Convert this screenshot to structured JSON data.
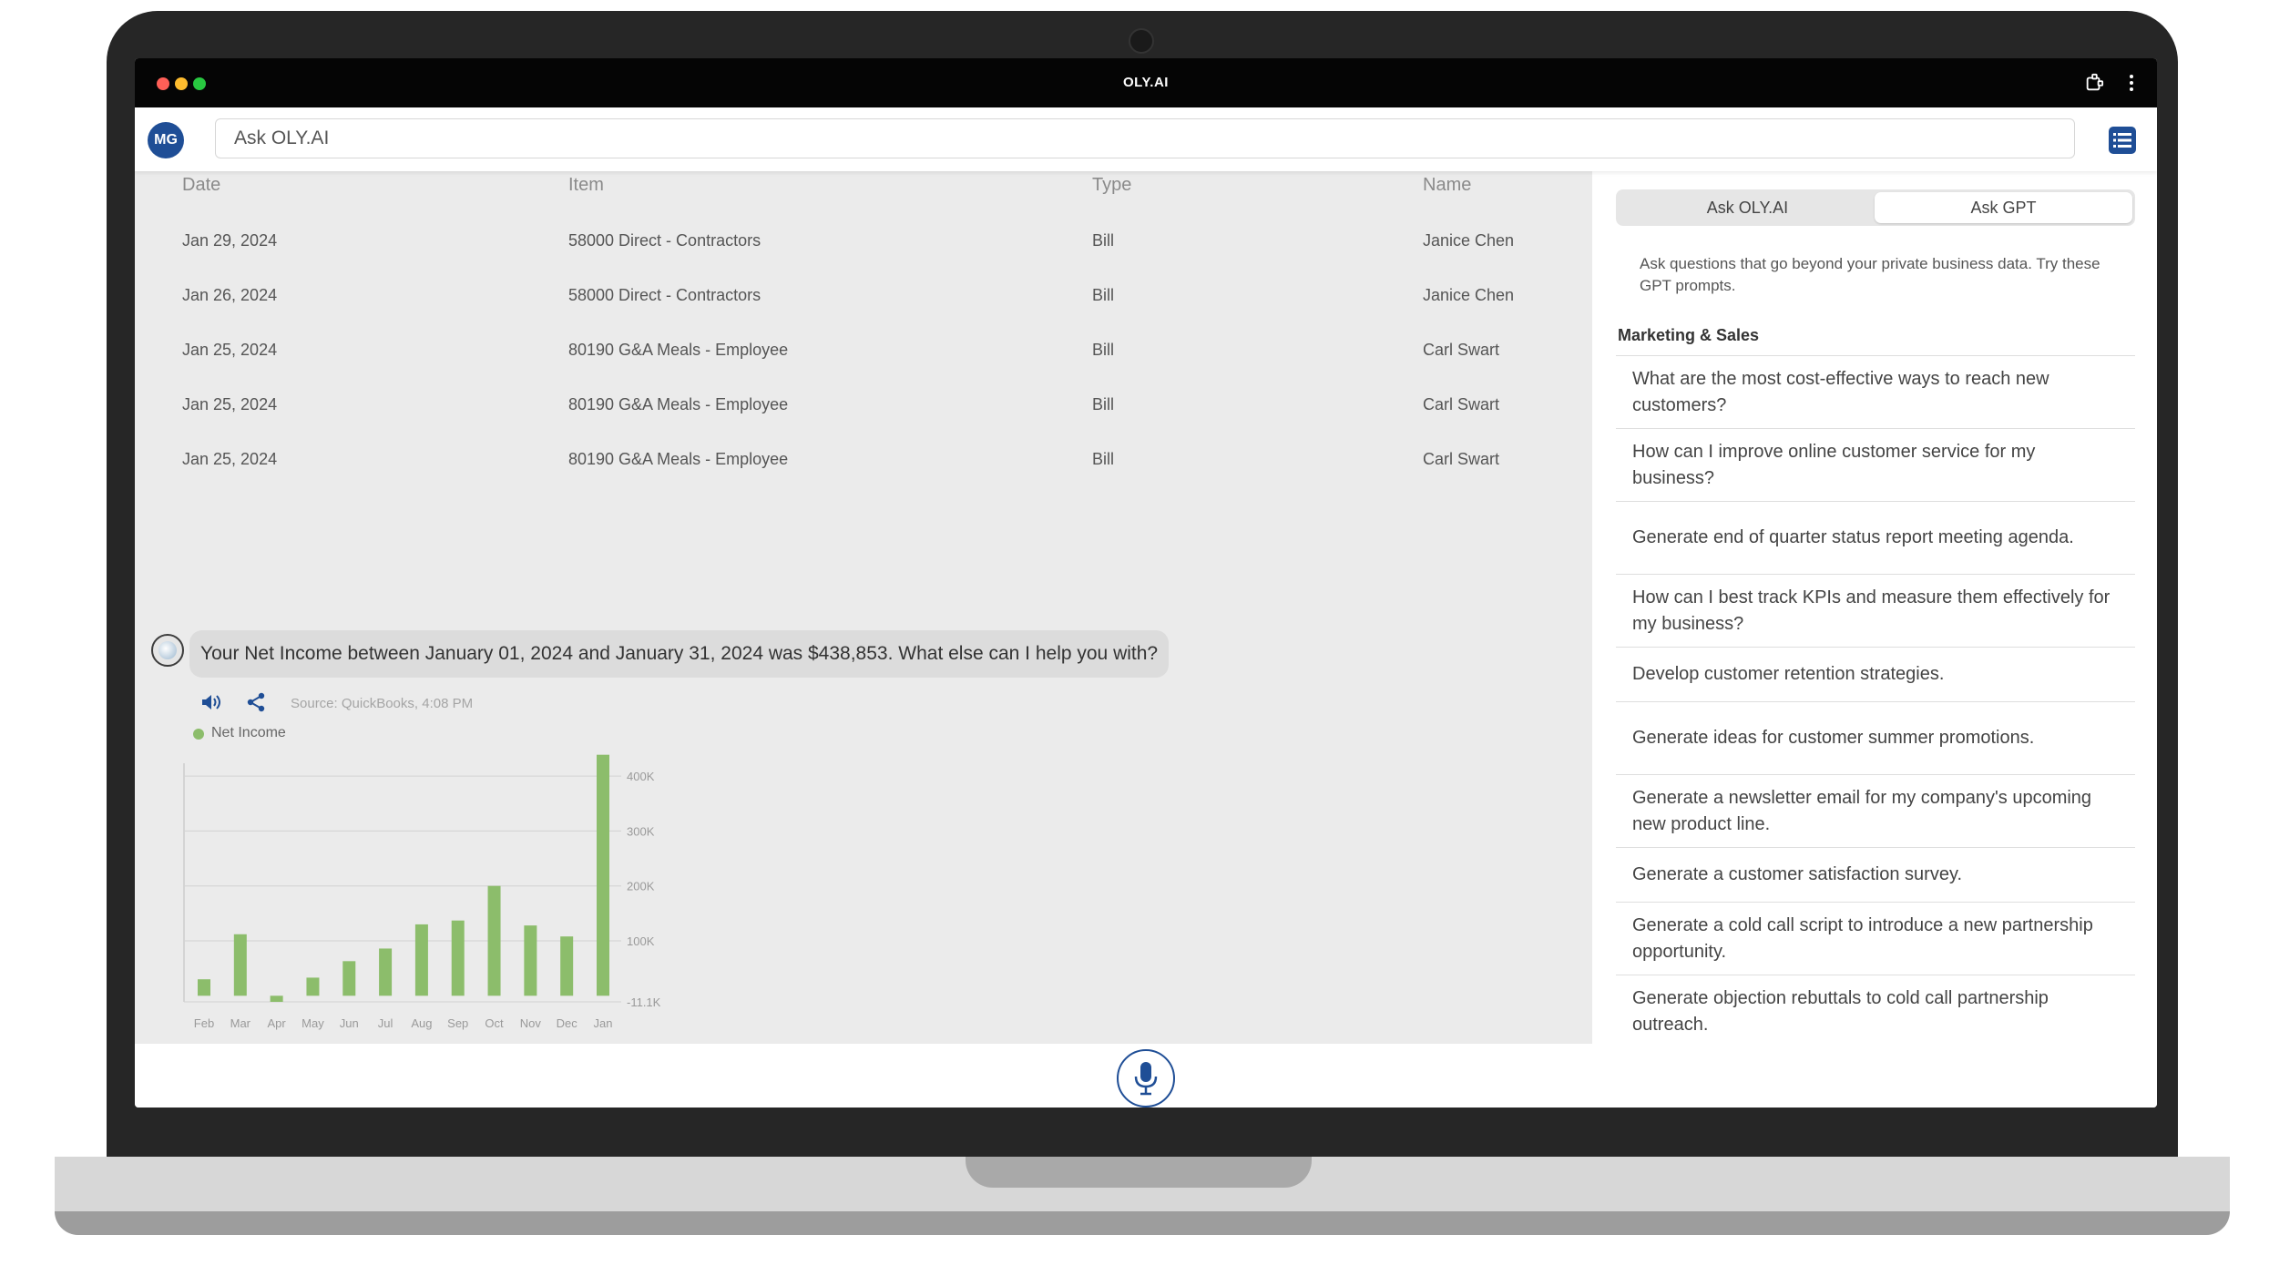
{
  "window": {
    "title": "OLY.AI"
  },
  "topbar": {
    "avatar_initials": "MG",
    "search_placeholder": "Ask OLY.AI"
  },
  "table": {
    "headers": [
      "Date",
      "Item",
      "Type",
      "Name"
    ],
    "rows": [
      [
        "Jan 29, 2024",
        "58000 Direct - Contractors",
        "Bill",
        "Janice Chen"
      ],
      [
        "Jan 26, 2024",
        "58000 Direct - Contractors",
        "Bill",
        "Janice Chen"
      ],
      [
        "Jan 25, 2024",
        "80190 G&A Meals - Employee",
        "Bill",
        "Carl Swart"
      ],
      [
        "Jan 25, 2024",
        "80190 G&A Meals - Employee",
        "Bill",
        "Carl Swart"
      ],
      [
        "Jan 25, 2024",
        "80190 G&A Meals - Employee",
        "Bill",
        "Carl Swart"
      ]
    ]
  },
  "chat": {
    "message": "Your Net Income between January 01, 2024 and January 31, 2024 was $438,853. What else can I help you with?",
    "source": "Source: QuickBooks, 4:08 PM"
  },
  "chart_data": {
    "type": "bar",
    "categories": [
      "Feb",
      "Mar",
      "Apr",
      "May",
      "Jun",
      "Jul",
      "Aug",
      "Sep",
      "Oct",
      "Nov",
      "Dec",
      "Jan"
    ],
    "series": [
      {
        "name": "Net Income",
        "values": [
          30000,
          112000,
          -11100,
          33000,
          63000,
          86000,
          130000,
          137000,
          200000,
          128000,
          108000,
          438853
        ]
      }
    ],
    "y_ticks": [
      "400K",
      "300K",
      "200K",
      "100K",
      "-11.1K"
    ],
    "y_tick_values": [
      400000,
      300000,
      200000,
      100000,
      -11100
    ],
    "ylim": [
      -11100,
      440000
    ],
    "legend": "top-left",
    "grid": true,
    "color": "#8cbd6b"
  },
  "right_panel": {
    "tabs": [
      "Ask OLY.AI",
      "Ask GPT"
    ],
    "active_tab": "Ask GPT",
    "intro": "Ask questions that go beyond your private business data. Try these GPT prompts.",
    "category": "Marketing & Sales",
    "prompts": [
      "What are the most cost-effective ways to reach new customers?",
      "How can I improve online customer service for my business?",
      "Generate end of quarter status report meeting agenda.",
      "How can I best track KPIs and measure them effectively for my business?",
      "Develop customer retention strategies.",
      "Generate ideas for customer summer promotions.",
      "Generate a newsletter email for my company's upcoming new product line.",
      "Generate a customer satisfaction survey.",
      "Generate a cold call script to introduce a new partnership opportunity.",
      "Generate objection rebuttals to cold call partnership outreach."
    ]
  },
  "colors": {
    "brand_blue": "#1f4e96",
    "chart_green": "#8cbd6b"
  },
  "icons": {
    "titlebar": [
      "extension-icon",
      "kebab-menu-icon"
    ],
    "topbar": [
      "list-icon"
    ],
    "chat": [
      "speaker-icon",
      "share-icon"
    ],
    "bottombar": [
      "microphone-icon"
    ]
  }
}
